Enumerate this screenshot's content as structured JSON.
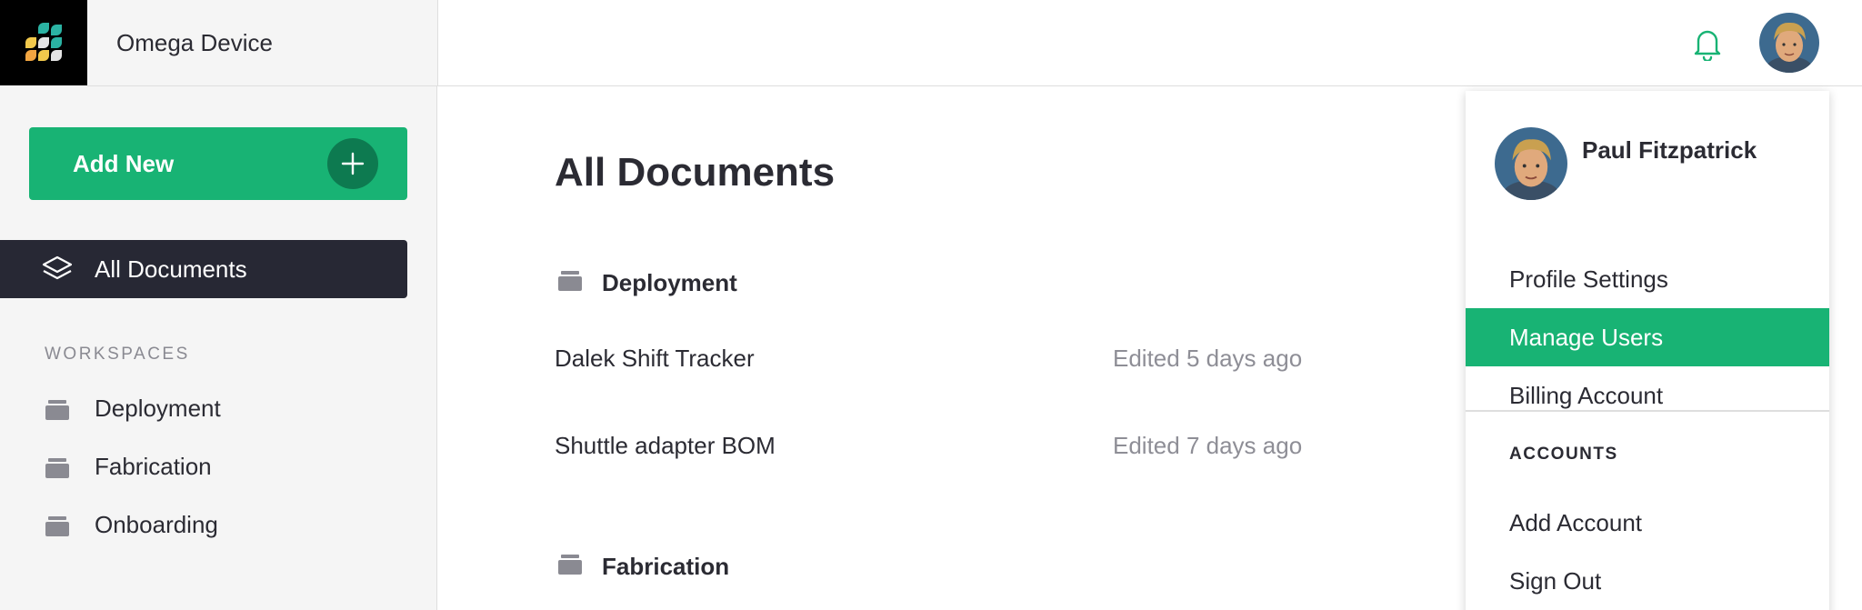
{
  "app": {
    "title": "Omega Device"
  },
  "header": {
    "bell_icon": "bell-icon",
    "accent_color": "#18b374"
  },
  "sidebar": {
    "add_new_label": "Add New",
    "active_item": {
      "label": "All Documents",
      "icon": "layers-icon"
    },
    "workspaces_heading": "WORKSPACES",
    "workspaces": [
      {
        "label": "Deployment",
        "icon": "folder-icon"
      },
      {
        "label": "Fabrication",
        "icon": "folder-icon"
      },
      {
        "label": "Onboarding",
        "icon": "folder-icon"
      }
    ]
  },
  "main": {
    "title": "All Documents",
    "groups": [
      {
        "name": "Deployment",
        "documents": [
          {
            "name": "Dalek Shift Tracker",
            "edited": "Edited 5 days ago"
          },
          {
            "name": "Shuttle adapter BOM",
            "edited": "Edited 7 days ago"
          }
        ]
      },
      {
        "name": "Fabrication",
        "documents": []
      }
    ]
  },
  "user_menu": {
    "name": "Paul Fitzpatrick",
    "items": [
      {
        "label": "Profile Settings",
        "active": false
      },
      {
        "label": "Manage Users",
        "active": true
      },
      {
        "label": "Billing Account",
        "active": false
      }
    ],
    "accounts_heading": "ACCOUNTS",
    "account_items": [
      {
        "label": "Add Account"
      },
      {
        "label": "Sign Out"
      }
    ]
  }
}
